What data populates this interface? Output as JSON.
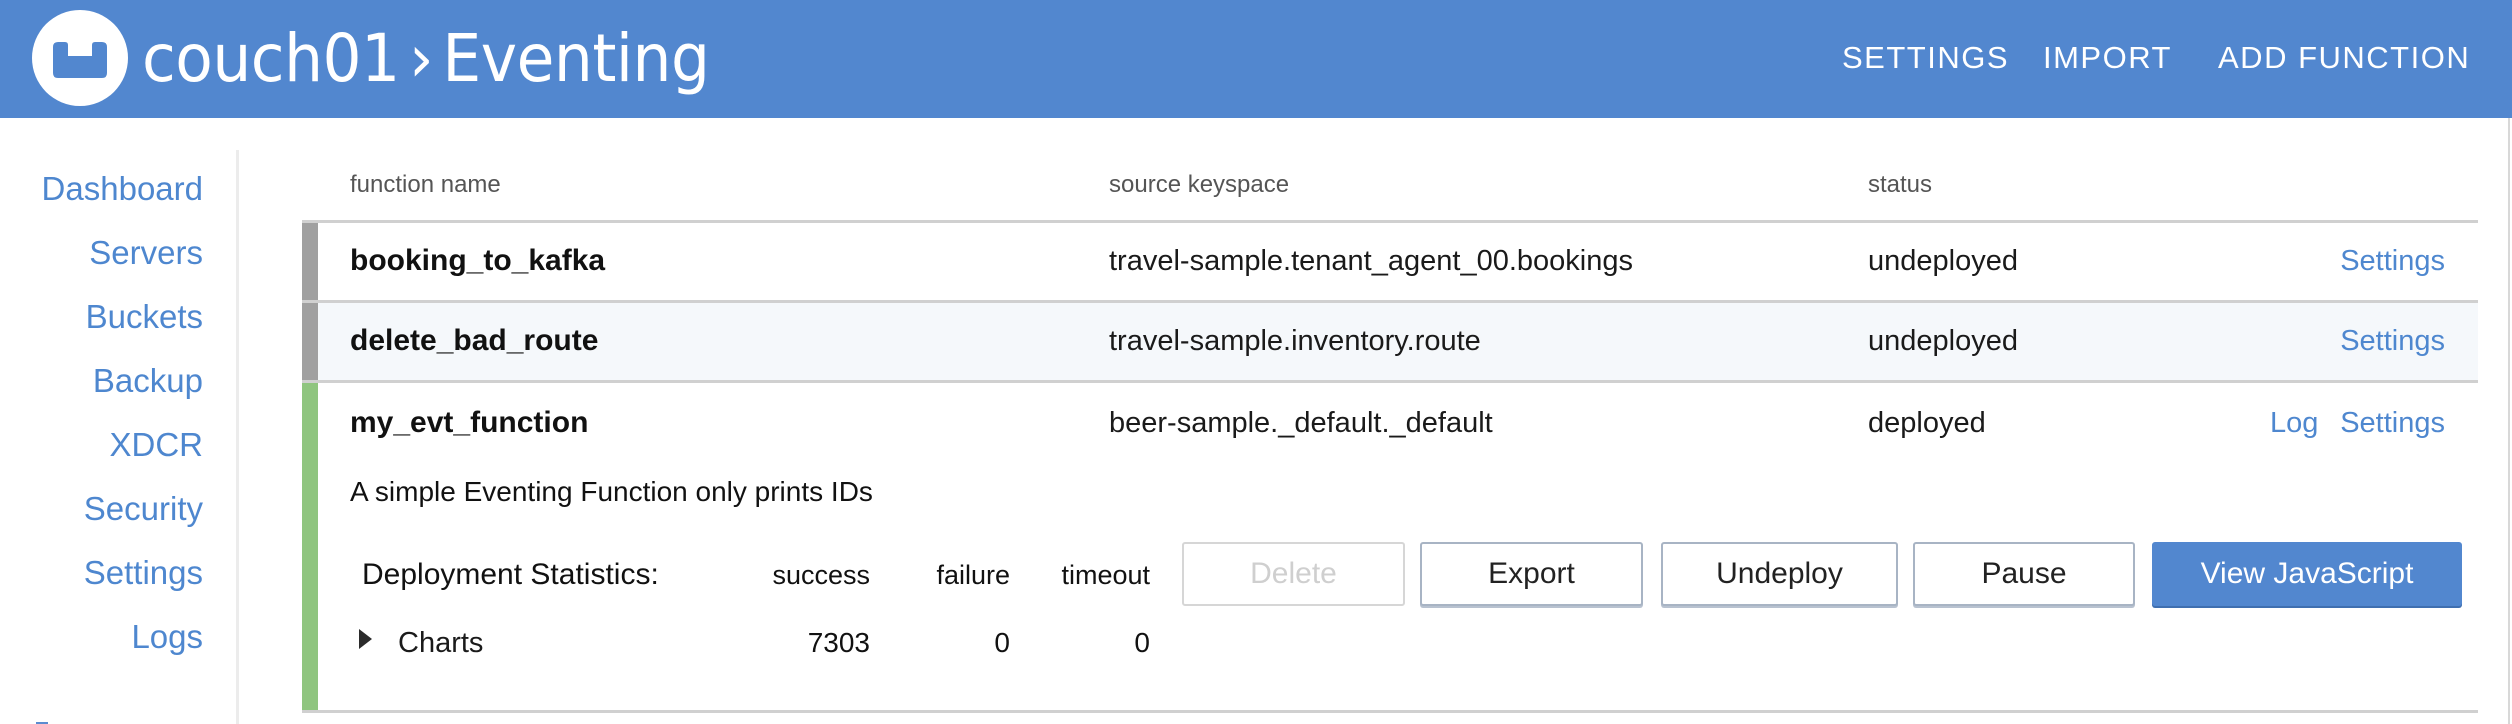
{
  "header": {
    "cluster": "couch01",
    "separator": "›",
    "page": "Eventing",
    "nav": [
      {
        "label": "SETTINGS"
      },
      {
        "label": "IMPORT"
      },
      {
        "label": "ADD FUNCTION"
      }
    ],
    "logo_icon": "couchbase-logo-icon"
  },
  "sidebar": {
    "items": [
      {
        "label": "Dashboard"
      },
      {
        "label": "Servers"
      },
      {
        "label": "Buckets"
      },
      {
        "label": "Backup"
      },
      {
        "label": "XDCR"
      },
      {
        "label": "Security"
      },
      {
        "label": "Settings"
      },
      {
        "label": "Logs"
      }
    ]
  },
  "table": {
    "columns": [
      "function name",
      "source keyspace",
      "status"
    ],
    "rows": [
      {
        "name": "booking_to_kafka",
        "keyspace": "travel-sample.tenant_agent_00.bookings",
        "status": "undeployed",
        "status_color": "#a0a0a0",
        "actions": [
          "Settings"
        ]
      },
      {
        "name": "delete_bad_route",
        "keyspace": "travel-sample.inventory.route",
        "status": "undeployed",
        "status_color": "#a0a0a0",
        "actions": [
          "Settings"
        ]
      },
      {
        "name": "my_evt_function",
        "keyspace": "beer-sample._default._default",
        "status": "deployed",
        "status_color": "#8fc57f",
        "actions": [
          "Log",
          "Settings"
        ],
        "description": "A simple Eventing Function only prints IDs",
        "stats": {
          "label": "Deployment Statistics:",
          "headers": [
            "success",
            "failure",
            "timeout"
          ],
          "values": [
            "7303",
            "0",
            "0"
          ],
          "charts_label": "Charts"
        },
        "buttons": [
          {
            "label": "Delete",
            "state": "disabled"
          },
          {
            "label": "Export",
            "state": "normal"
          },
          {
            "label": "Undeploy",
            "state": "normal"
          },
          {
            "label": "Pause",
            "state": "normal"
          },
          {
            "label": "View JavaScript",
            "state": "primary"
          }
        ]
      }
    ]
  },
  "colors": {
    "brand": "#5287cf",
    "link": "#4e87cf",
    "deployed": "#8fc57f",
    "undeployed": "#a0a0a0",
    "row_alt": "#f5f8fb"
  }
}
